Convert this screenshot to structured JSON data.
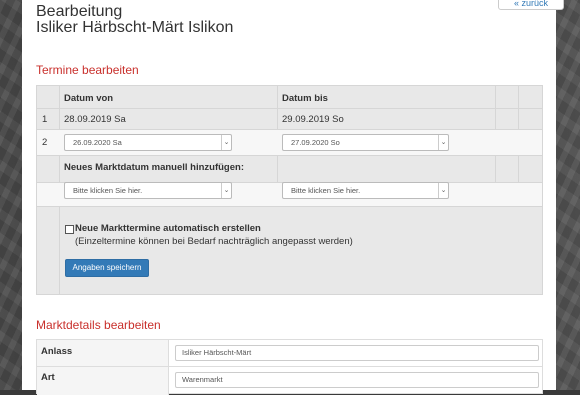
{
  "header": {
    "title_line1": "Bearbeitung",
    "title_line2": "Isliker Härbscht-Märt Islikon",
    "back_label": "« zurück"
  },
  "termine": {
    "section_title": "Termine bearbeiten",
    "col_from": "Datum von",
    "col_to": "Datum bis",
    "rows": [
      {
        "num": "1",
        "from": "28.09.2019 Sa",
        "to": "29.09.2019 So"
      },
      {
        "num": "2",
        "from_select": "26.09.2020 Sa",
        "to_select": "27.09.2020 So"
      }
    ],
    "add_label": "Neues Marktdatum manuell hinzufügen:",
    "add_from_placeholder": "Bitte klicken Sie hier.",
    "add_to_placeholder": "Bitte klicken Sie hier.",
    "auto_label": "Neue Markttermine automatisch erstellen",
    "auto_note": "(Einzeltermine können bei Bedarf nachträglich angepasst werden)",
    "save_label": "Angaben speichern"
  },
  "details": {
    "section_title": "Marktdetails bearbeiten",
    "rows": [
      {
        "label": "Anlass",
        "value": "Isliker Härbscht-Märt"
      },
      {
        "label": "Art",
        "value": "Warenmarkt"
      }
    ]
  }
}
